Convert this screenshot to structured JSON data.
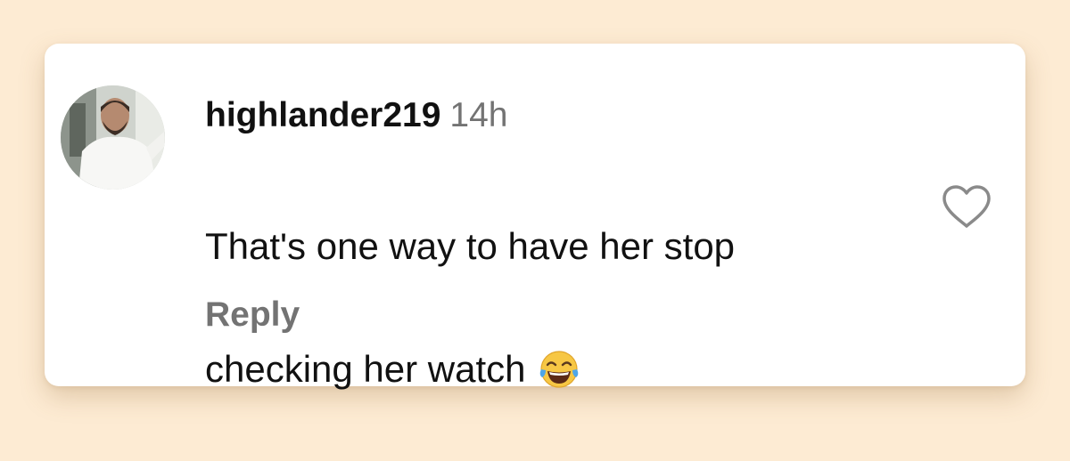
{
  "comment": {
    "username": "highlander219",
    "time": "14h",
    "text_line1": "That's one way to have her stop",
    "text_line2": "checking her watch",
    "emoji": "tears-of-joy-emoji",
    "reply_label": "Reply",
    "like_icon": "heart-outline-icon"
  },
  "colors": {
    "background": "#fdebd3",
    "card": "#ffffff",
    "primary_text": "#111111",
    "secondary_text": "#737373"
  }
}
